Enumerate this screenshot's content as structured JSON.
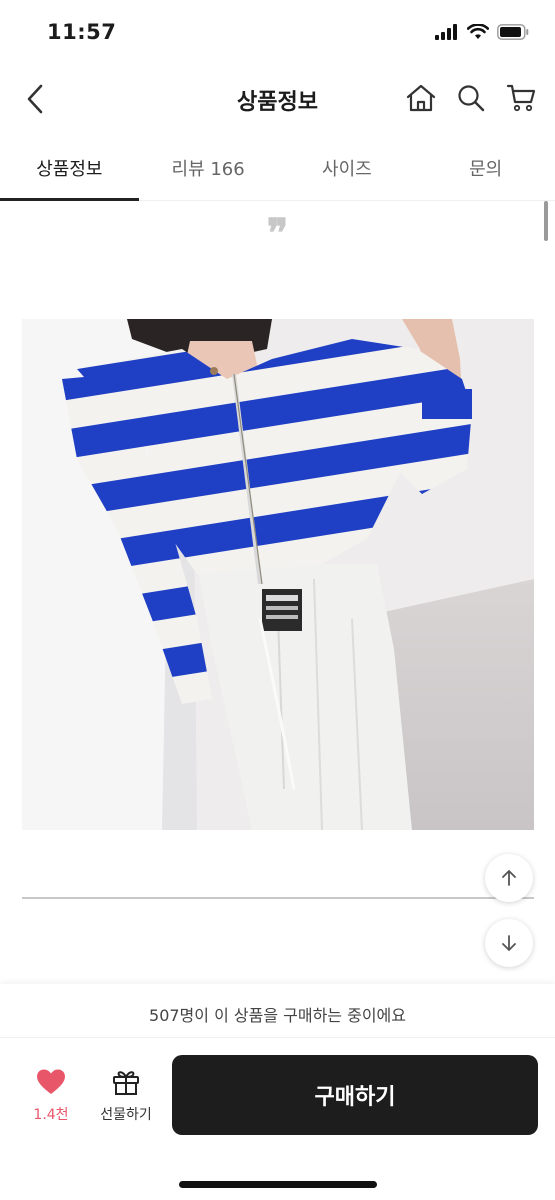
{
  "status_bar": {
    "time": "11:57"
  },
  "header": {
    "title": "상품정보"
  },
  "tabs": [
    {
      "label": "상품정보",
      "active": true
    },
    {
      "label": "리뷰 166",
      "active": false
    },
    {
      "label": "사이즈",
      "active": false
    },
    {
      "label": "문의",
      "active": false
    }
  ],
  "content": {
    "quote_mark": "❞",
    "product_image": "Striped blue-and-white cropped zip-up knit cardigan with white ribbed pants"
  },
  "bottom": {
    "buyers_note": "507명이 이 상품을 구매하는 중이에요",
    "like_count": "1.4천",
    "gift_label": "선물하기",
    "buy_label": "구매하기"
  },
  "colors": {
    "accent_like": "#e8566a",
    "buy_button": "#1d1d1d",
    "stripe_blue": "#1f3fc4"
  },
  "icons": [
    "back-arrow-icon",
    "home-icon",
    "search-icon",
    "cart-icon",
    "heart-icon",
    "gift-icon",
    "arrow-up-icon",
    "arrow-down-icon"
  ]
}
